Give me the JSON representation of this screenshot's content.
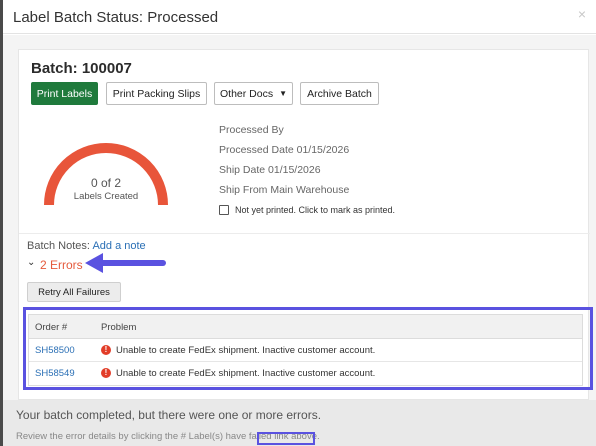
{
  "modal": {
    "title": "Label Batch Status: Processed",
    "close_glyph": "×"
  },
  "batch": {
    "title": "Batch: 100007"
  },
  "toolbar": {
    "print_labels": "Print Labels",
    "print_packing_slips": "Print Packing Slips",
    "other_docs": "Other Docs",
    "other_docs_caret": "▼",
    "archive_batch": "Archive Batch"
  },
  "gauge": {
    "value_text": "0 of 2",
    "caption": "Labels Created",
    "progress_fraction": 0,
    "color": "#e8553a"
  },
  "info": {
    "processed_by": "Processed By",
    "processed_date": "Processed Date 01/15/2026",
    "ship_date": "Ship Date 01/15/2026",
    "ship_from": "Ship From Main Warehouse",
    "print_checkbox_label": "Not yet printed. Click to mark as printed."
  },
  "notes": {
    "label": "Batch Notes:",
    "add_link": "Add a note"
  },
  "errors": {
    "chevron": "⌄",
    "toggle_label": "2 Errors",
    "retry_button": "Retry All Failures",
    "columns": [
      "Order #",
      "Problem"
    ],
    "rows": [
      {
        "order": "SH58500",
        "problem": "Unable to create FedEx shipment. Inactive customer account."
      },
      {
        "order": "SH58549",
        "problem": "Unable to create FedEx shipment. Inactive customer account."
      }
    ]
  },
  "footer": {
    "message": "Your batch completed, but there were one or more errors.",
    "detail": "Review the error details by clicking the # Label(s) have failed link above."
  },
  "colors": {
    "primary_green": "#1f7a3c",
    "error_red": "#e55a3c",
    "link_blue": "#2a6fb5",
    "annotation_purple": "#5a52e0"
  }
}
